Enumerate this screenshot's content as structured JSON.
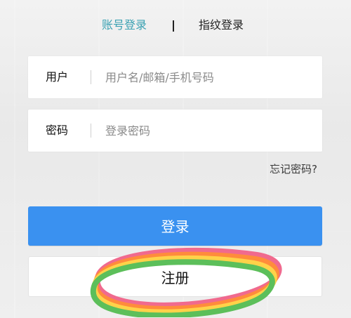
{
  "tabs": {
    "account_login": "账号登录",
    "fingerprint_login": "指纹登录"
  },
  "username": {
    "label": "用户",
    "placeholder": "用户名/邮箱/手机号码"
  },
  "password": {
    "label": "密码",
    "placeholder": "登录密码"
  },
  "forgot_password": "忘记密码?",
  "buttons": {
    "login": "登录",
    "register": "注册"
  },
  "colors": {
    "active_tab": "#3aa1b2",
    "primary": "#3a91f0",
    "highlight_colors": [
      "#f06a8e",
      "#ff8c3a",
      "#ffd24a",
      "#5bbf5a"
    ]
  }
}
